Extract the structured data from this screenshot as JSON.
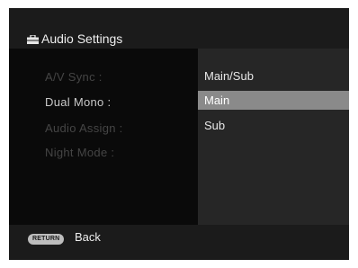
{
  "header": {
    "icon": "toolbox-icon",
    "title": "Audio Settings"
  },
  "menu": {
    "items": [
      {
        "label": "A/V Sync :",
        "state": "disabled"
      },
      {
        "label": "Dual Mono :",
        "state": "active"
      },
      {
        "label": "Audio Assign :",
        "state": "disabled"
      },
      {
        "label": "Night Mode :",
        "state": "disabled"
      }
    ]
  },
  "options": {
    "items": [
      {
        "label": "Main/Sub"
      },
      {
        "label": "Main"
      },
      {
        "label": "Sub"
      }
    ],
    "selected": "Main"
  },
  "footer": {
    "return_button": "RETURN",
    "back_label": "Back"
  },
  "colors": {
    "frame": "#1b1b1b",
    "menu_panel": "#0a0a0a",
    "options_panel": "#262626",
    "selection": "#8a8a8a"
  }
}
